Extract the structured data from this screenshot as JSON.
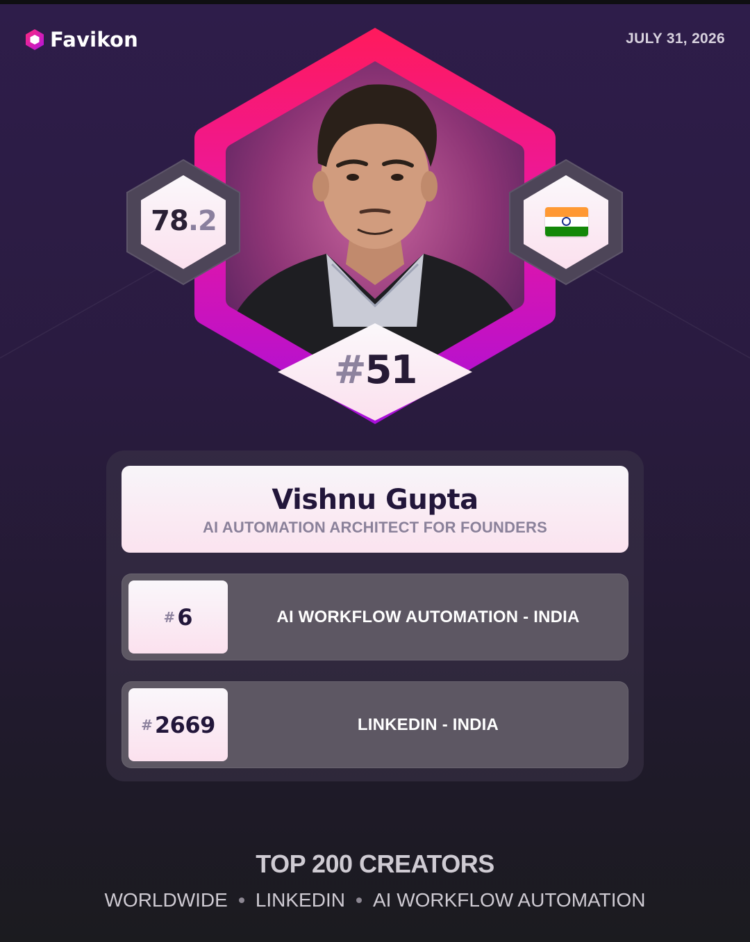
{
  "brand": {
    "name": "Favikon"
  },
  "date": "JULY 31, 2026",
  "profile": {
    "score_int": "78",
    "score_dec": ".2",
    "overall_rank_hash": "#",
    "overall_rank": "51",
    "country_flag": "india-flag-icon",
    "name": "Vishnu Gupta",
    "title": "AI AUTOMATION ARCHITECT FOR FOUNDERS"
  },
  "rankings": [
    {
      "hash": "#",
      "rank": "6",
      "label": "AI WORKFLOW AUTOMATION - INDIA"
    },
    {
      "hash": "#",
      "rank": "2669",
      "label": "LINKEDIN - INDIA"
    }
  ],
  "footer": {
    "title": "TOP 200 CREATORS",
    "tags": [
      "WORLDWIDE",
      "LINKEDIN",
      "AI WORKFLOW AUTOMATION"
    ]
  },
  "colors": {
    "accent_pink": "#ff1f6b",
    "accent_purple": "#b011d8",
    "background": "#2a1b40"
  }
}
